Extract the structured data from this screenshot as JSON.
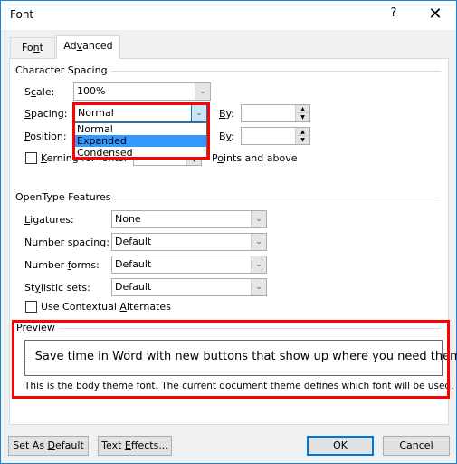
{
  "window": {
    "title": "Font",
    "help_label": "?",
    "close_label": "✕"
  },
  "tabs": [
    {
      "label_pre": "Fo",
      "label_ul": "n",
      "label_post": "t",
      "active": false
    },
    {
      "label_pre": "Ad",
      "label_ul": "v",
      "label_post": "anced",
      "active": true
    }
  ],
  "character_spacing": {
    "group_label": "Character Spacing",
    "scale": {
      "label_pre": "S",
      "label_ul": "c",
      "label_post": "ale:",
      "value": "100%"
    },
    "spacing": {
      "label_pre": "",
      "label_ul": "S",
      "label_post": "pacing:",
      "value": "Normal",
      "options": [
        "Normal",
        "Expanded",
        "Condensed"
      ],
      "highlighted": "Expanded"
    },
    "spacing_by": {
      "label_pre": "",
      "label_ul": "B",
      "label_post": "y:",
      "value": ""
    },
    "position": {
      "label_pre": "",
      "label_ul": "P",
      "label_post": "osition:"
    },
    "position_by": {
      "label_pre": "B",
      "label_ul": "y",
      "label_post": ":",
      "value": ""
    },
    "kerning": {
      "label_pre": "",
      "label_ul": "K",
      "label_post": "erning for fonts:",
      "checked": false
    },
    "points_and_above": {
      "label_pre": "P",
      "label_ul": "o",
      "label_post": "ints and above"
    }
  },
  "opentype": {
    "group_label": "OpenType Features",
    "ligatures": {
      "label_pre": "",
      "label_ul": "L",
      "label_post": "igatures:",
      "value": "None"
    },
    "number_spacing": {
      "label_pre": "Nu",
      "label_ul": "m",
      "label_post": "ber spacing:",
      "value": "Default"
    },
    "number_forms": {
      "label_pre": "Number ",
      "label_ul": "f",
      "label_post": "orms:",
      "value": "Default"
    },
    "stylistic_sets": {
      "label_pre": "St",
      "label_ul": "y",
      "label_post": "listic sets:",
      "value": "Default"
    },
    "contextual_alternates": {
      "label_pre": "Use Contextual ",
      "label_ul": "A",
      "label_post": "lternates",
      "checked": false
    }
  },
  "preview": {
    "group_label": "Preview",
    "sample": "_ Save time in Word with new buttons that show up where you need them. _",
    "note": "This is the body theme font. The current document theme defines which font will be used."
  },
  "buttons": {
    "set_default": {
      "pre": "Set As ",
      "ul": "D",
      "post": "efault"
    },
    "text_effects": {
      "pre": "Text ",
      "ul": "E",
      "post": "ffects..."
    },
    "ok": "OK",
    "cancel": "Cancel"
  },
  "colors": {
    "accent": "#0078d7",
    "highlight": "#3399ff",
    "annotation": "#ff0000"
  }
}
